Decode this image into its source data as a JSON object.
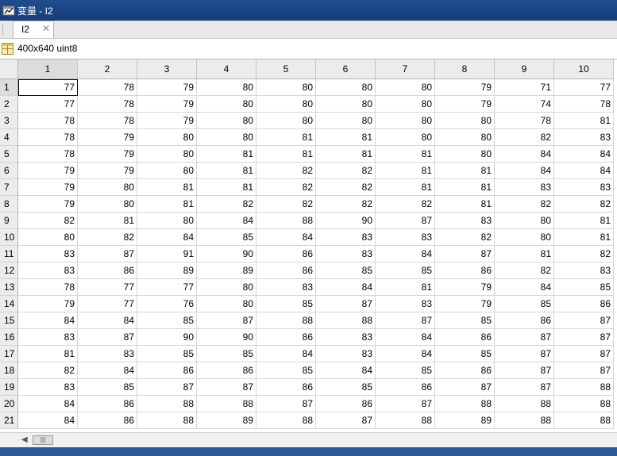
{
  "window": {
    "title": "变量 - I2"
  },
  "tab": {
    "label": "I2",
    "close_glyph": "✕"
  },
  "info": {
    "text": "400x640 uint8",
    "icon": "grid-icon"
  },
  "scrollbar": {
    "left_arrow": "◀",
    "thumb_glyph": "|||"
  },
  "table": {
    "columns": [
      "1",
      "2",
      "3",
      "4",
      "5",
      "6",
      "7",
      "8",
      "9",
      "10"
    ],
    "rows": [
      {
        "h": "1",
        "v": [
          "77",
          "78",
          "79",
          "80",
          "80",
          "80",
          "80",
          "79",
          "71",
          "77"
        ]
      },
      {
        "h": "2",
        "v": [
          "77",
          "78",
          "79",
          "80",
          "80",
          "80",
          "80",
          "79",
          "74",
          "78"
        ]
      },
      {
        "h": "3",
        "v": [
          "78",
          "78",
          "79",
          "80",
          "80",
          "80",
          "80",
          "80",
          "78",
          "81"
        ]
      },
      {
        "h": "4",
        "v": [
          "78",
          "79",
          "80",
          "80",
          "81",
          "81",
          "80",
          "80",
          "82",
          "83"
        ]
      },
      {
        "h": "5",
        "v": [
          "78",
          "79",
          "80",
          "81",
          "81",
          "81",
          "81",
          "80",
          "84",
          "84"
        ]
      },
      {
        "h": "6",
        "v": [
          "79",
          "79",
          "80",
          "81",
          "82",
          "82",
          "81",
          "81",
          "84",
          "84"
        ]
      },
      {
        "h": "7",
        "v": [
          "79",
          "80",
          "81",
          "81",
          "82",
          "82",
          "81",
          "81",
          "83",
          "83"
        ]
      },
      {
        "h": "8",
        "v": [
          "79",
          "80",
          "81",
          "82",
          "82",
          "82",
          "82",
          "81",
          "82",
          "82"
        ]
      },
      {
        "h": "9",
        "v": [
          "82",
          "81",
          "80",
          "84",
          "88",
          "90",
          "87",
          "83",
          "80",
          "81"
        ]
      },
      {
        "h": "10",
        "v": [
          "80",
          "82",
          "84",
          "85",
          "84",
          "83",
          "83",
          "82",
          "80",
          "81"
        ]
      },
      {
        "h": "11",
        "v": [
          "83",
          "87",
          "91",
          "90",
          "86",
          "83",
          "84",
          "87",
          "81",
          "82"
        ]
      },
      {
        "h": "12",
        "v": [
          "83",
          "86",
          "89",
          "89",
          "86",
          "85",
          "85",
          "86",
          "82",
          "83"
        ]
      },
      {
        "h": "13",
        "v": [
          "78",
          "77",
          "77",
          "80",
          "83",
          "84",
          "81",
          "79",
          "84",
          "85"
        ]
      },
      {
        "h": "14",
        "v": [
          "79",
          "77",
          "76",
          "80",
          "85",
          "87",
          "83",
          "79",
          "85",
          "86"
        ]
      },
      {
        "h": "15",
        "v": [
          "84",
          "84",
          "85",
          "87",
          "88",
          "88",
          "87",
          "85",
          "86",
          "87"
        ]
      },
      {
        "h": "16",
        "v": [
          "83",
          "87",
          "90",
          "90",
          "86",
          "83",
          "84",
          "86",
          "87",
          "87"
        ]
      },
      {
        "h": "17",
        "v": [
          "81",
          "83",
          "85",
          "85",
          "84",
          "83",
          "84",
          "85",
          "87",
          "87"
        ]
      },
      {
        "h": "18",
        "v": [
          "82",
          "84",
          "86",
          "86",
          "85",
          "84",
          "85",
          "86",
          "87",
          "87"
        ]
      },
      {
        "h": "19",
        "v": [
          "83",
          "85",
          "87",
          "87",
          "86",
          "85",
          "86",
          "87",
          "87",
          "88"
        ]
      },
      {
        "h": "20",
        "v": [
          "84",
          "86",
          "88",
          "88",
          "87",
          "86",
          "87",
          "88",
          "88",
          "88"
        ]
      },
      {
        "h": "21",
        "v": [
          "84",
          "86",
          "88",
          "89",
          "88",
          "87",
          "88",
          "89",
          "88",
          "88"
        ]
      }
    ]
  }
}
